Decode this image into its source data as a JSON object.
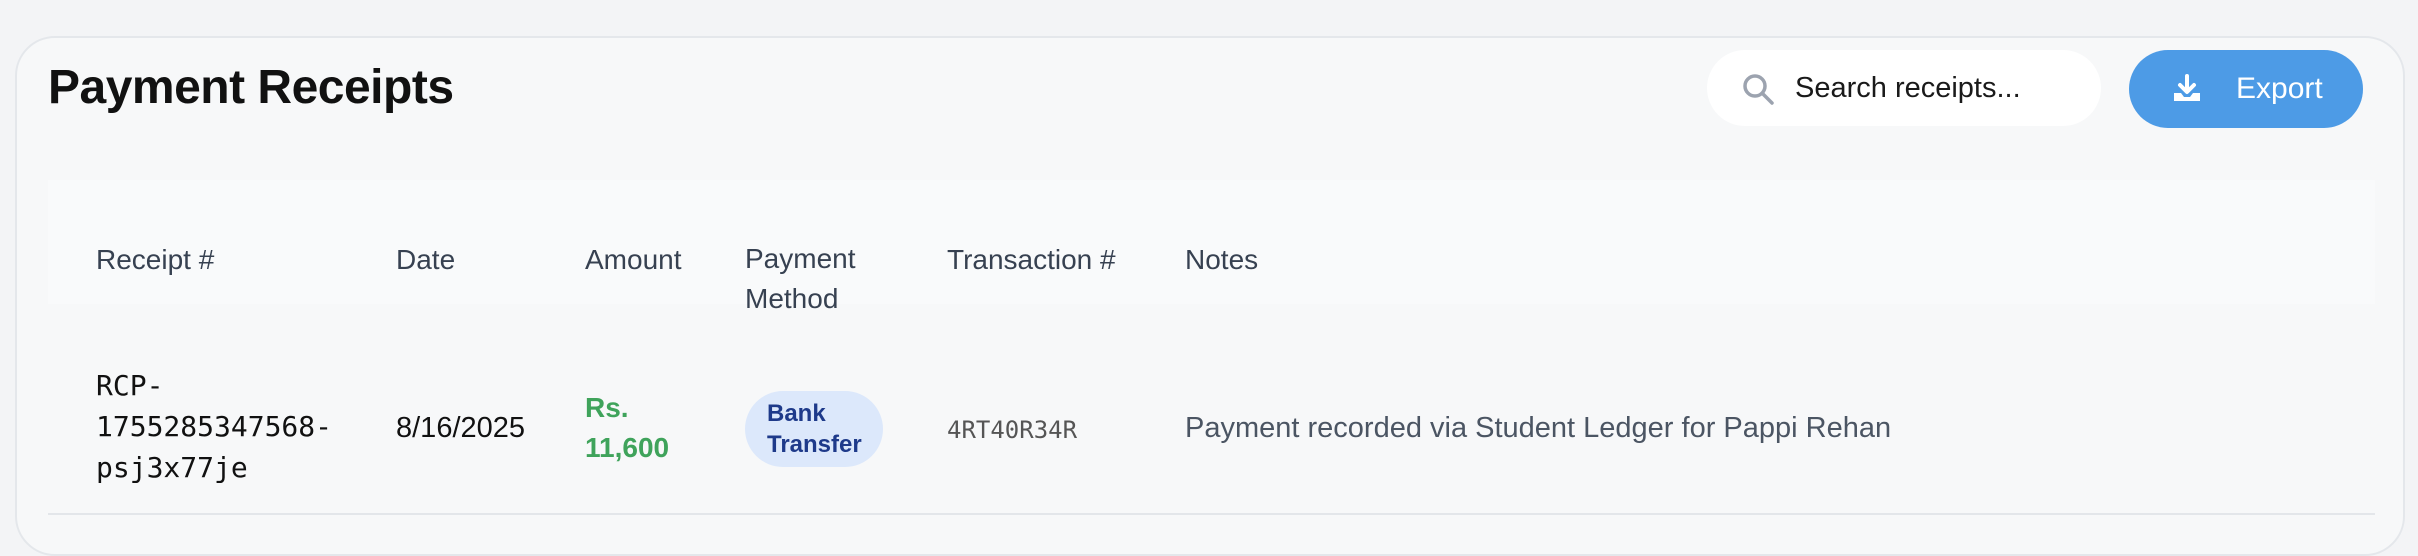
{
  "header": {
    "title": "Payment Receipts",
    "search_placeholder": "Search receipts...",
    "export_label": "Export"
  },
  "table": {
    "columns": [
      "Receipt #",
      "Date",
      "Amount",
      "Payment\nMethod",
      "Transaction #",
      "Notes"
    ],
    "rows": [
      {
        "receipt": "RCP-\n1755285347568-\npsj3x77je",
        "date": "8/16/2025",
        "amount": "Rs.\n11,600",
        "payment_method": "Bank\nTransfer",
        "transaction": "4RT40R34R",
        "notes": "Payment recorded via Student Ledger for Pappi Rehan"
      }
    ]
  },
  "colors": {
    "accent": "#4d9be6",
    "amount_green": "#3fa35b",
    "badge_bg": "#dce8fb",
    "badge_text": "#1e3a8a"
  },
  "icons": {
    "search": "search-icon",
    "export": "download-icon"
  }
}
